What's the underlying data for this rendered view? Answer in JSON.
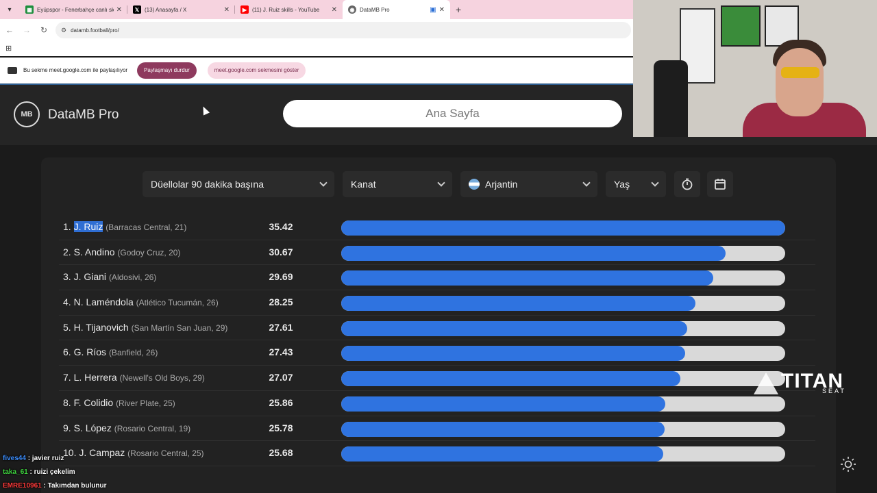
{
  "browser": {
    "tabs": [
      {
        "title": "Eyüpspor - Fenerbahçe canlı sk",
        "favicon": "sheets-icon",
        "color": "#1e8e3e"
      },
      {
        "title": "(13) Anasayfa / X",
        "favicon": "x-icon",
        "color": "#000000"
      },
      {
        "title": "(11) J. Ruiz skills - YouTube",
        "favicon": "youtube-icon",
        "color": "#ff0000"
      },
      {
        "title": "DataMB Pro",
        "favicon": "datamb-icon",
        "color": "#555555",
        "active": true
      }
    ],
    "url": "datamb.football/pro/",
    "new_tab": "+"
  },
  "share_bar": {
    "text": "Bu sekme meet.google.com ile paylaşılıyor",
    "stop_label": "Paylaşmayı durdur",
    "show_label": "meet.google.com sekmesini göster"
  },
  "site": {
    "logo_text": "MB",
    "brand": "DataMB Pro",
    "search_text": "Ana Sayfa"
  },
  "filters": {
    "metric": "Düellolar 90 dakika başına",
    "position": "Kanat",
    "country": "Arjantin",
    "age": "Yaş"
  },
  "rankings": [
    {
      "rank": "1.",
      "player": "J. Ruiz",
      "club": "(Barracas Central, 21)",
      "value": "35.42",
      "ratio": 1.0,
      "highlight": true
    },
    {
      "rank": "2.",
      "player": "S. Andino",
      "club": "(Godoy Cruz, 20)",
      "value": "30.67",
      "ratio": 0.866
    },
    {
      "rank": "3.",
      "player": "J. Giani",
      "club": "(Aldosivi, 26)",
      "value": "29.69",
      "ratio": 0.838
    },
    {
      "rank": "4.",
      "player": "N. Laméndola",
      "club": "(Atlético Tucumán, 26)",
      "value": "28.25",
      "ratio": 0.798
    },
    {
      "rank": "5.",
      "player": "H. Tijanovich",
      "club": "(San Martín San Juan, 29)",
      "value": "27.61",
      "ratio": 0.78
    },
    {
      "rank": "6.",
      "player": "G. Ríos",
      "club": "(Banfield, 26)",
      "value": "27.43",
      "ratio": 0.774
    },
    {
      "rank": "7.",
      "player": "L. Herrera",
      "club": "(Newell's Old Boys, 29)",
      "value": "27.07",
      "ratio": 0.764
    },
    {
      "rank": "8.",
      "player": "F. Colidio",
      "club": "(River Plate, 25)",
      "value": "25.86",
      "ratio": 0.73
    },
    {
      "rank": "9.",
      "player": "S. López",
      "club": "(Rosario Central, 19)",
      "value": "25.78",
      "ratio": 0.728
    },
    {
      "rank": "10.",
      "player": "J. Campaz",
      "club": "(Rosario Central, 25)",
      "value": "25.68",
      "ratio": 0.725
    }
  ],
  "sponsor": {
    "name": "TITAN",
    "sub": "SEAT"
  },
  "chat": [
    {
      "user": "fives44",
      "text": " : javier ruiz"
    },
    {
      "user": "taka_61",
      "text": " : ruizi çekelim"
    },
    {
      "user": "EMRE10961",
      "text": " : Takımdan bulunur"
    }
  ]
}
